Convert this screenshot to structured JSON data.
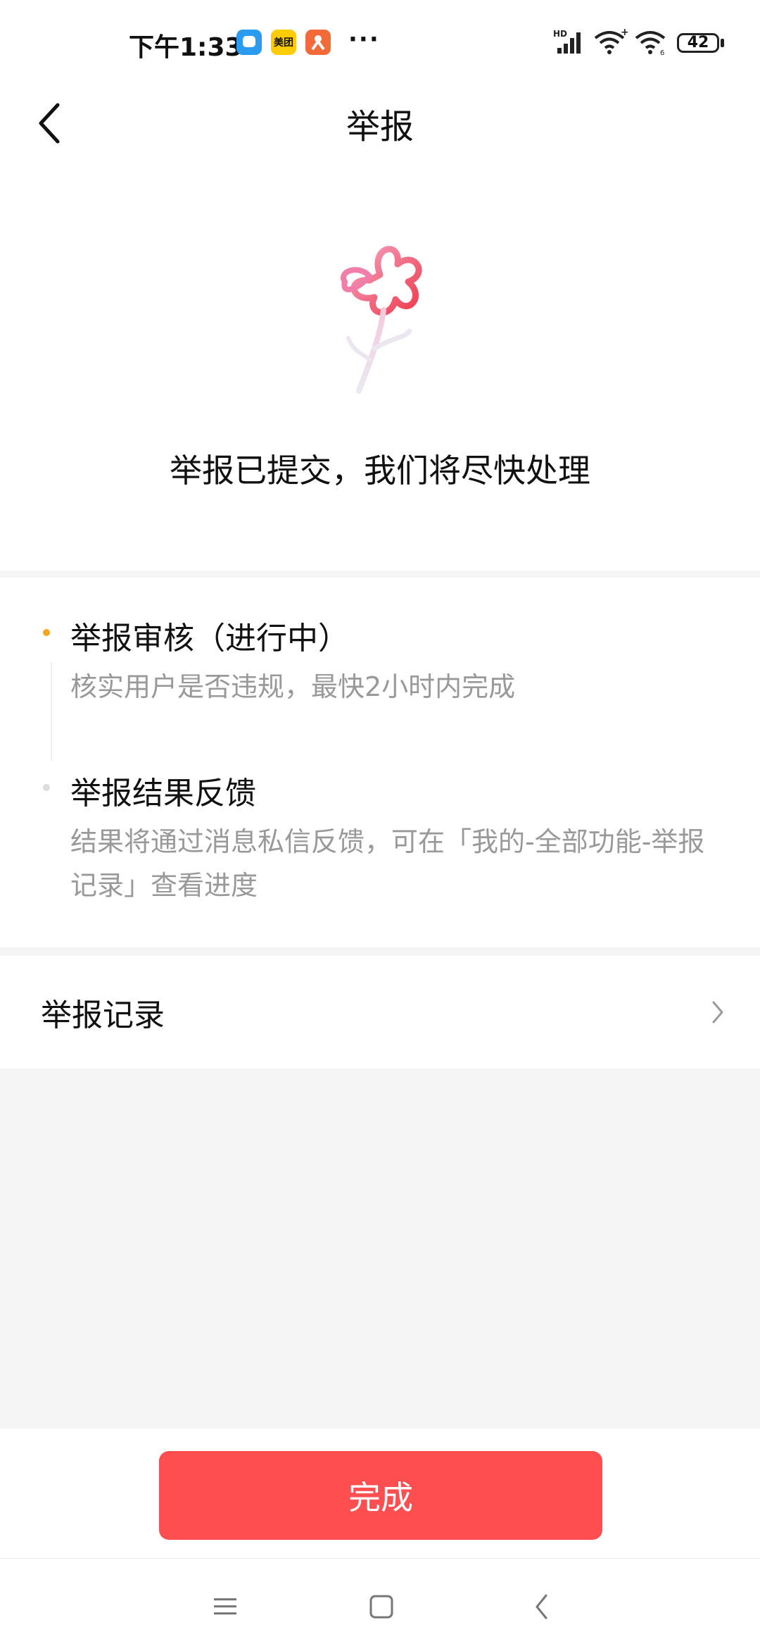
{
  "status_bar": {
    "time": "下午1:33",
    "app_icons": [
      {
        "name": "message-app-icon",
        "color": "#2b9bf0"
      },
      {
        "name": "meituan-app-icon",
        "label": "美团",
        "color": "#ffcc00"
      },
      {
        "name": "orange-app-icon",
        "color": "#f26a3a"
      }
    ],
    "more": "···",
    "network_label": "HD",
    "battery": "42"
  },
  "header": {
    "title": "举报"
  },
  "hero": {
    "message": "举报已提交，我们将尽快处理"
  },
  "steps": [
    {
      "title": "举报审核（进行中）",
      "description": "核实用户是否违规，最快2小时内完成",
      "active": true,
      "dot_color": "#f5a623"
    },
    {
      "title": "举报结果反馈",
      "description": "结果将通过消息私信反馈，可在「我的-全部功能-举报记录」查看进度",
      "active": false,
      "dot_color": "#dddddd"
    }
  ],
  "record": {
    "label": "举报记录"
  },
  "footer": {
    "done_label": "完成",
    "accent_color": "#fe4e50"
  }
}
